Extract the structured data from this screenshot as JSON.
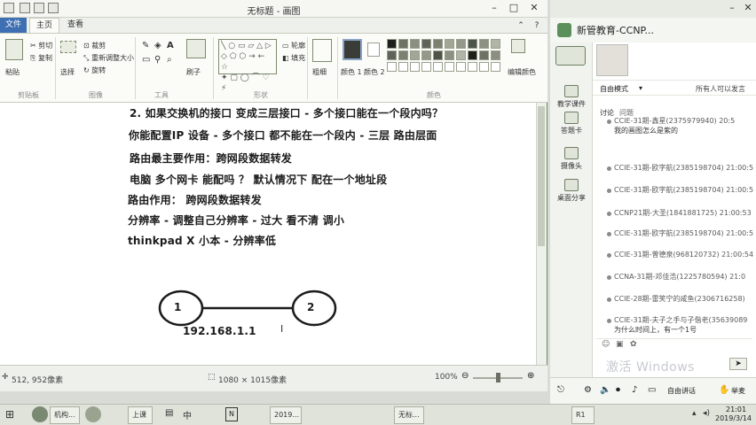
{
  "paint": {
    "title": "无标题 - 画图",
    "menu": {
      "file": "文件",
      "home": "主页",
      "view": "查看"
    },
    "ribbon": {
      "paste": "粘贴",
      "cut": "剪切",
      "copy": "复制",
      "select": "选择",
      "crop": "裁剪",
      "resize": "重新调整大小",
      "rotate": "旋转",
      "brush": "刷子",
      "outline": "轮廓",
      "fill": "填充",
      "thickness": "粗细",
      "color1": "颜色 1",
      "color2": "颜色 2",
      "edit_colors": "编辑颜色",
      "groups": {
        "clipboard": "剪贴板",
        "image": "图像",
        "tools": "工具",
        "shapes": "形状",
        "colors": "颜色"
      }
    },
    "canvas": {
      "lines": [
        "2. 如果交换机的接口 变成三层接口 - 多个接口能在一个段内吗？",
        "你能配置IP 设备  - 多个接口 都不能在一个段内 - 三层 路由层面",
        "路由最主要作用：跨网段数据转发",
        "电脑 多个网卡 能配吗 ？ 默认情况下  配在一个地址段",
        "路由作用：  跨网段数据转发",
        "分辨率 - 调整自己分辨率 - 过大 看不清  调小",
        "thinkpad X 小本 - 分辨率低"
      ],
      "node_a": "1",
      "node_b": "2",
      "ip_label": "192.168.1.1"
    },
    "status": {
      "cursor": "512, 952像素",
      "dimensions": "1080 × 1015像素",
      "zoom": "100%"
    }
  },
  "chat": {
    "title": "新管教育-CCNP...",
    "mode": "自由模式",
    "scope": "所有人可以发言",
    "discussion_tab": "讨论",
    "question_tab": "问题",
    "left_nav": [
      "教学课件",
      "答题卡",
      "摄像头",
      "桌面分享"
    ],
    "messages": [
      "CCIE-31期-鑫星(2375979940)  20:5",
      "我的画图怎么是紫的",
      "CCIE-31期-欧字航(2385198704)  21:00:5",
      "CCIE-31期-欧字航(2385198704)  21:00:5",
      "CCNP21期-大圣(1841881725)  21:00:53",
      "CCIE-31期-欧字航(2385198704)  21:00:5",
      "CCIE-31期-曾德泉(968120732)  21:00:54",
      "CCNA-31期-邓佳浩(1225780594)  21:0",
      "CCIE-28期-雷笑宁的咸鱼(2306716258)",
      "CCIE-31期-夫子之手与子偕老(35639089",
      "为什么时间上，有一个1号"
    ],
    "activate_windows": "激活 Windows",
    "input_bar": {
      "free_speech": "自由讲话",
      "raise_hand": "举麦"
    }
  },
  "taskbar": {
    "items": [
      "机构...",
      "上课",
      "2019...",
      "无标...",
      "R1"
    ],
    "ime": "中",
    "time": "21:01",
    "date": "2019/3/14"
  },
  "colors": {
    "paint_file_tab": "#3e6fb2",
    "color1_swatch": "#3a3c38",
    "canvas_bg": "#ffffff"
  }
}
